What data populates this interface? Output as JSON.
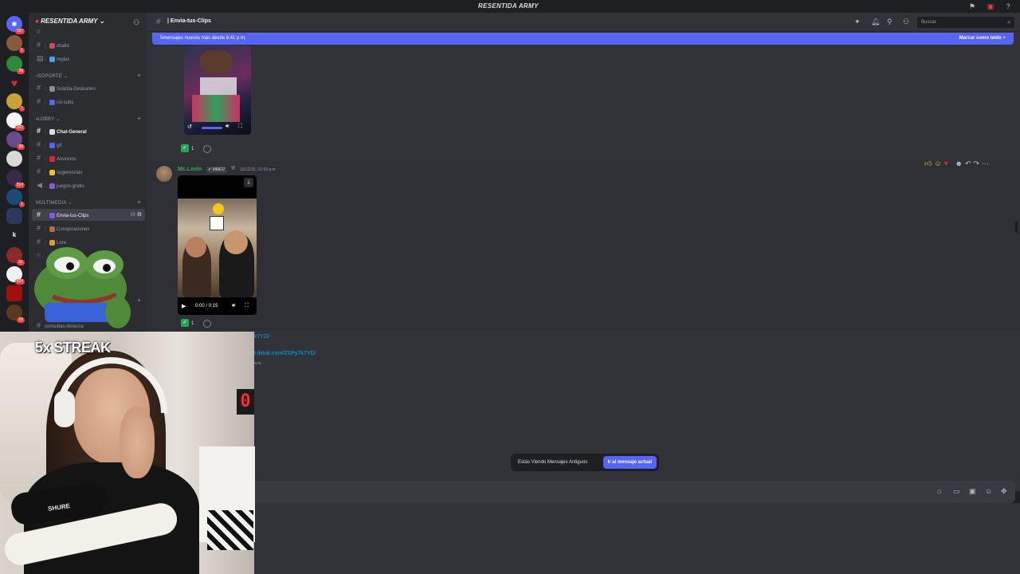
{
  "app": {
    "title": "RESENTIDA ARMY"
  },
  "server_rail": {
    "badges": [
      "197",
      "1",
      "28",
      "",
      "1",
      "102",
      "38",
      "",
      "314",
      "1",
      "",
      "",
      "31",
      "424",
      "",
      "16"
    ]
  },
  "sidebar": {
    "guild_name": "RESENTIDA ARMY",
    "top_channels": [
      {
        "label": "chalto"
      },
      {
        "label": "reglas"
      }
    ],
    "categories": [
      {
        "name": "SOPORTE",
        "channels": [
          {
            "label": "Solicita-Desbaneo"
          },
          {
            "label": "rol-subs"
          }
        ]
      },
      {
        "name": "LOBBY",
        "channels": [
          {
            "label": "Chat-General"
          },
          {
            "label": "gif"
          },
          {
            "label": "Anuncios"
          },
          {
            "label": "sugerencias"
          },
          {
            "label": "juegos-gratis"
          }
        ]
      },
      {
        "name": "MULTIMEDIA",
        "channels": [
          {
            "label": "Envia-tus-Clips"
          },
          {
            "label": "Conspiraciones"
          },
          {
            "label": "Lore"
          }
        ]
      }
    ],
    "bottom_channel": "consultas-minecra"
  },
  "header": {
    "channel": "Envia-tus-Clips",
    "search_placeholder": "Buscar"
  },
  "new_messages_bar": {
    "text": "5mensajes nuevos más desde 8:41 p.m.",
    "mark_read": "Marcar como leído"
  },
  "messages": [
    {
      "reaction_count": "1"
    },
    {
      "author": "Mc.Lovin",
      "tag": "MMGV",
      "timestamp": "15/12/25, 12:33 a.m.",
      "video_time": "0:00 / 0:15",
      "reaction_count": "1"
    }
  ],
  "links": {
    "partial_1": "k7YD/",
    "partial_2": "t.tiktok.com/ZSPy7k7YD/",
    "partial_ts": "a.m."
  },
  "old_messages": {
    "text": "Estás Viendo Mensajes Antiguos",
    "button": "Ir al mensaje actual"
  },
  "overlay": {
    "streak": "5x STREAK",
    "mic_brand": "SHURE",
    "counter_digit": "0"
  },
  "colors": {
    "accent": "#5865f2",
    "author": "#3ba55d",
    "link": "#00a8fc"
  }
}
